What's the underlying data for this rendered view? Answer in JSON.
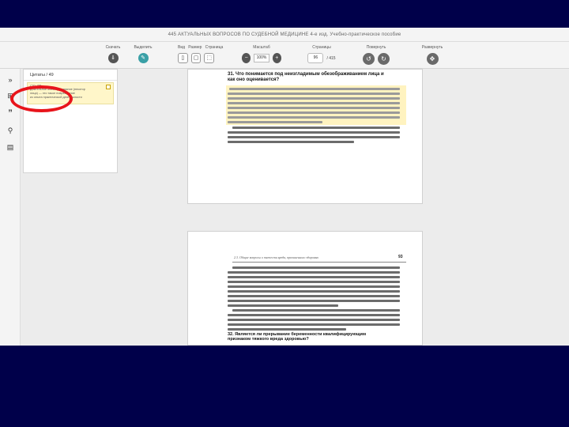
{
  "app": {
    "title": "445 АКТУАЛЬНЫХ ВОПРОСОВ ПО СУДЕБНОЙ МЕДИЦИНЕ 4-е изд. Учебно-практическое пособие"
  },
  "toolbar": {
    "save_label": "Скачать",
    "highlight_label": "Выделить",
    "view_label": "Вид",
    "size_label": "Размер",
    "page_label": "Страница",
    "zoom_label": "Масштаб",
    "zoom_value": "100%",
    "pages_label": "Страницы",
    "current_page": "96",
    "total_pages": "/ 415",
    "rotate_label": "Повернуть",
    "fullscreen_label": "Развернуть",
    "zoom_out": "−",
    "zoom_in": "+"
  },
  "side_panel": {
    "header": "Цитаты / 49",
    "quote_page": "стр. 96",
    "quote_line1": "Длительное обезображивание (некотор",
    "quote_line2": "лица) — это такое повреждение",
    "quote_line3": "из опыта практической деятельности"
  },
  "page1": {
    "question": "31. Что понимается под неизгладимым обезображиванием лица и как оно оценивается?"
  },
  "page2": {
    "running_head": "2.3. Общие вопросы о тяжести вреда, причиненного здоровью",
    "page_number": "93",
    "question": "32. Является ли прерывание беременности квалифицирующим признаком тяжкого вреда здоровью?"
  },
  "colors": {
    "slide_bg": "#00004a",
    "highlight": "#fff3c0",
    "annotation": "#e8141b",
    "accent": "#3aa0a6"
  }
}
